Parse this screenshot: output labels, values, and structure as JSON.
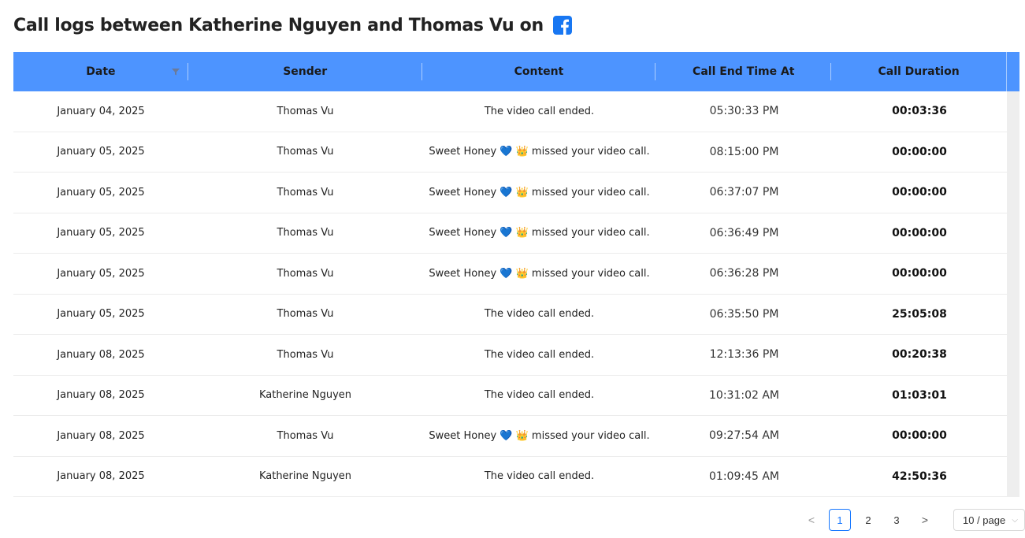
{
  "header": {
    "title": "Call logs between Katherine Nguyen and Thomas Vu on",
    "icon": "facebook-icon",
    "icon_color": "#1877f2"
  },
  "table": {
    "header_color": "#4d94ff",
    "columns": [
      "Date",
      "Sender",
      "Content",
      "Call End Time At",
      "Call Duration"
    ],
    "rows": [
      {
        "date": "January 04, 2025",
        "sender": "Thomas Vu",
        "content": "The video call ended.",
        "end": "05:30:33 PM",
        "duration": "00:03:36"
      },
      {
        "date": "January 05, 2025",
        "sender": "Thomas Vu",
        "content": "Sweet Honey 💙 👑 missed your video call.",
        "end": "08:15:00 PM",
        "duration": "00:00:00"
      },
      {
        "date": "January 05, 2025",
        "sender": "Thomas Vu",
        "content": "Sweet Honey 💙 👑 missed your video call.",
        "end": "06:37:07 PM",
        "duration": "00:00:00"
      },
      {
        "date": "January 05, 2025",
        "sender": "Thomas Vu",
        "content": "Sweet Honey 💙 👑 missed your video call.",
        "end": "06:36:49 PM",
        "duration": "00:00:00"
      },
      {
        "date": "January 05, 2025",
        "sender": "Thomas Vu",
        "content": "Sweet Honey 💙 👑 missed your video call.",
        "end": "06:36:28 PM",
        "duration": "00:00:00"
      },
      {
        "date": "January 05, 2025",
        "sender": "Thomas Vu",
        "content": "The video call ended.",
        "end": "06:35:50 PM",
        "duration": "25:05:08"
      },
      {
        "date": "January 08, 2025",
        "sender": "Thomas Vu",
        "content": "The video call ended.",
        "end": "12:13:36 PM",
        "duration": "00:20:38"
      },
      {
        "date": "January 08, 2025",
        "sender": "Katherine Nguyen",
        "content": "The video call ended.",
        "end": "10:31:02 AM",
        "duration": "01:03:01"
      },
      {
        "date": "January 08, 2025",
        "sender": "Thomas Vu",
        "content": "Sweet Honey 💙 👑 missed your video call.",
        "end": "09:27:54 AM",
        "duration": "00:00:00"
      },
      {
        "date": "January 08, 2025",
        "sender": "Katherine Nguyen",
        "content": "The video call ended.",
        "end": "01:09:45 AM",
        "duration": "42:50:36"
      }
    ]
  },
  "pagination": {
    "prev": "<",
    "pages": [
      "1",
      "2",
      "3"
    ],
    "active_page": "1",
    "next": ">",
    "page_size": "10 / page"
  }
}
